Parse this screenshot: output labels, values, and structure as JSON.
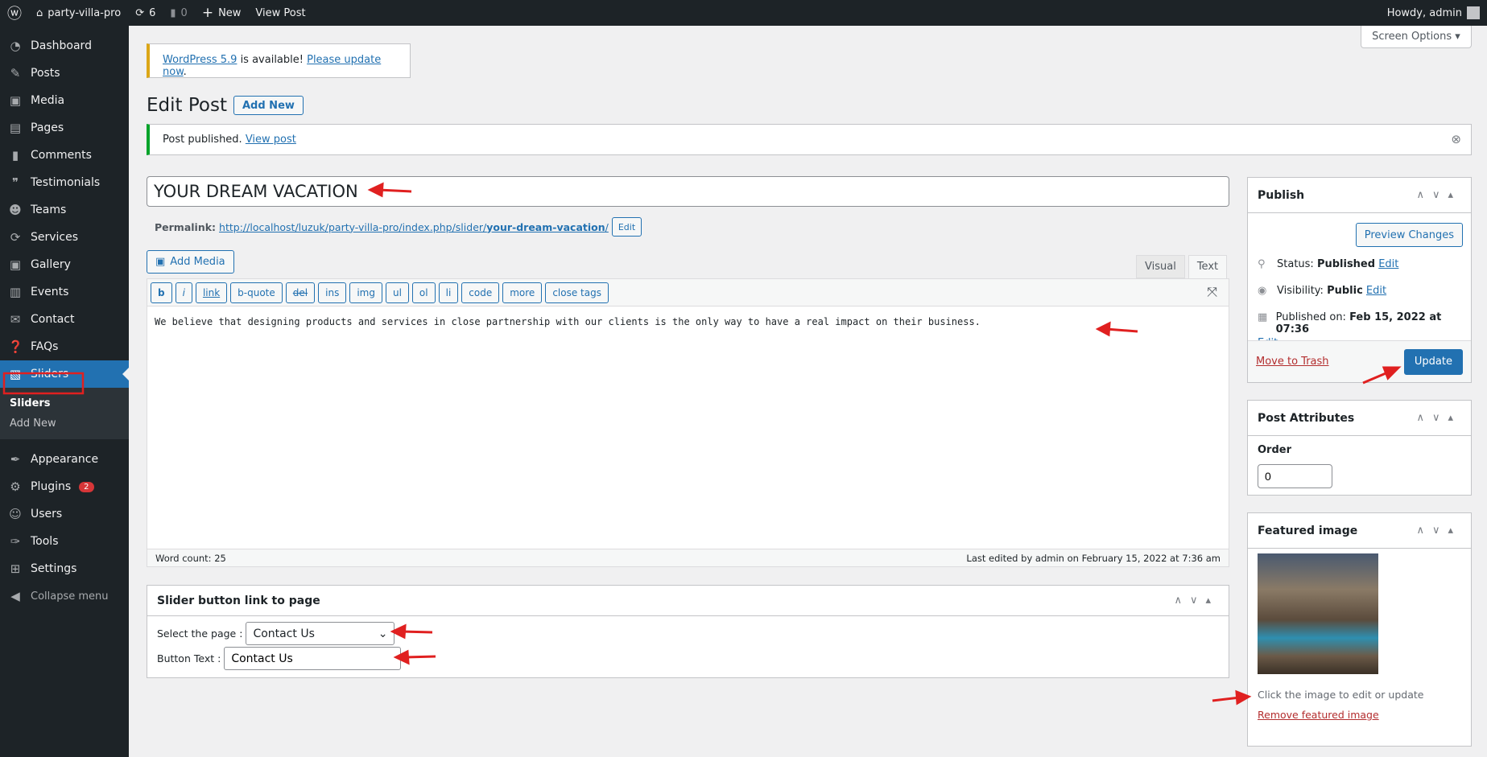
{
  "adminbar": {
    "site": "party-villa-pro",
    "updates": "6",
    "comments": "0",
    "new": "New",
    "view_post": "View Post",
    "howdy": "Howdy, admin"
  },
  "sidebar": {
    "items": [
      {
        "label": "Dashboard",
        "icon": "dashboard-icon"
      },
      {
        "label": "Posts",
        "icon": "pin-icon"
      },
      {
        "label": "Media",
        "icon": "media-icon"
      },
      {
        "label": "Pages",
        "icon": "pages-icon"
      },
      {
        "label": "Comments",
        "icon": "comments-icon"
      },
      {
        "label": "Testimonials",
        "icon": "testimonial-icon"
      },
      {
        "label": "Teams",
        "icon": "groups-icon"
      },
      {
        "label": "Services",
        "icon": "update-icon"
      },
      {
        "label": "Gallery",
        "icon": "media-icon"
      },
      {
        "label": "Events",
        "icon": "events-icon"
      },
      {
        "label": "Contact",
        "icon": "email-icon"
      },
      {
        "label": "FAQs",
        "icon": "faq-icon"
      },
      {
        "label": "Sliders",
        "icon": "slides-icon",
        "active": true
      }
    ],
    "submenu": [
      "Sliders",
      "Add New"
    ],
    "items2": [
      {
        "label": "Appearance"
      },
      {
        "label": "Plugins",
        "badge": "2"
      },
      {
        "label": "Users"
      },
      {
        "label": "Tools"
      },
      {
        "label": "Settings"
      }
    ],
    "collapse": "Collapse menu"
  },
  "screen_options": "Screen Options",
  "notice_update": {
    "link1": "WordPress 5.9",
    "mid": " is available! ",
    "link2": "Please update now",
    "end": "."
  },
  "heading": "Edit Post",
  "add_new": "Add New",
  "notice_published": {
    "text": "Post published. ",
    "link": "View post"
  },
  "title": "YOUR DREAM VACATION",
  "permalink": {
    "label": "Permalink:",
    "url": "http://localhost/luzuk/party-villa-pro/index.php/slider/",
    "slug": "your-dream-vacation",
    "end": "/",
    "edit": "Edit"
  },
  "editor": {
    "add_media": "Add Media",
    "tabs": [
      "Visual",
      "Text"
    ],
    "quicktags": [
      "b",
      "i",
      "link",
      "b-quote",
      "del",
      "ins",
      "img",
      "ul",
      "ol",
      "li",
      "code",
      "more",
      "close tags"
    ],
    "content": "We believe that designing products and services in close partnership with our clients is the only way to have a real impact on their business.",
    "word_count": "Word count: 25",
    "last_edited": "Last edited by admin on February 15, 2022 at 7:36 am"
  },
  "slider_box": {
    "title": "Slider button link to page",
    "select_label": "Select the page :",
    "select_value": "Contact Us",
    "text_label": "Button Text :",
    "text_value": "Contact Us"
  },
  "publish": {
    "title": "Publish",
    "preview": "Preview Changes",
    "status_label": "Status: ",
    "status": "Published",
    "visibility_label": "Visibility: ",
    "visibility": "Public",
    "published_label": "Published on: ",
    "published": "Feb 15, 2022 at 07:36",
    "edit": "Edit",
    "trash": "Move to Trash",
    "update": "Update"
  },
  "attributes": {
    "title": "Post Attributes",
    "order_label": "Order",
    "order": "0"
  },
  "featured": {
    "title": "Featured image",
    "hint": "Click the image to edit or update",
    "remove": "Remove featured image"
  },
  "colors": {
    "accent": "#2271b1",
    "annotation": "#e02020"
  }
}
